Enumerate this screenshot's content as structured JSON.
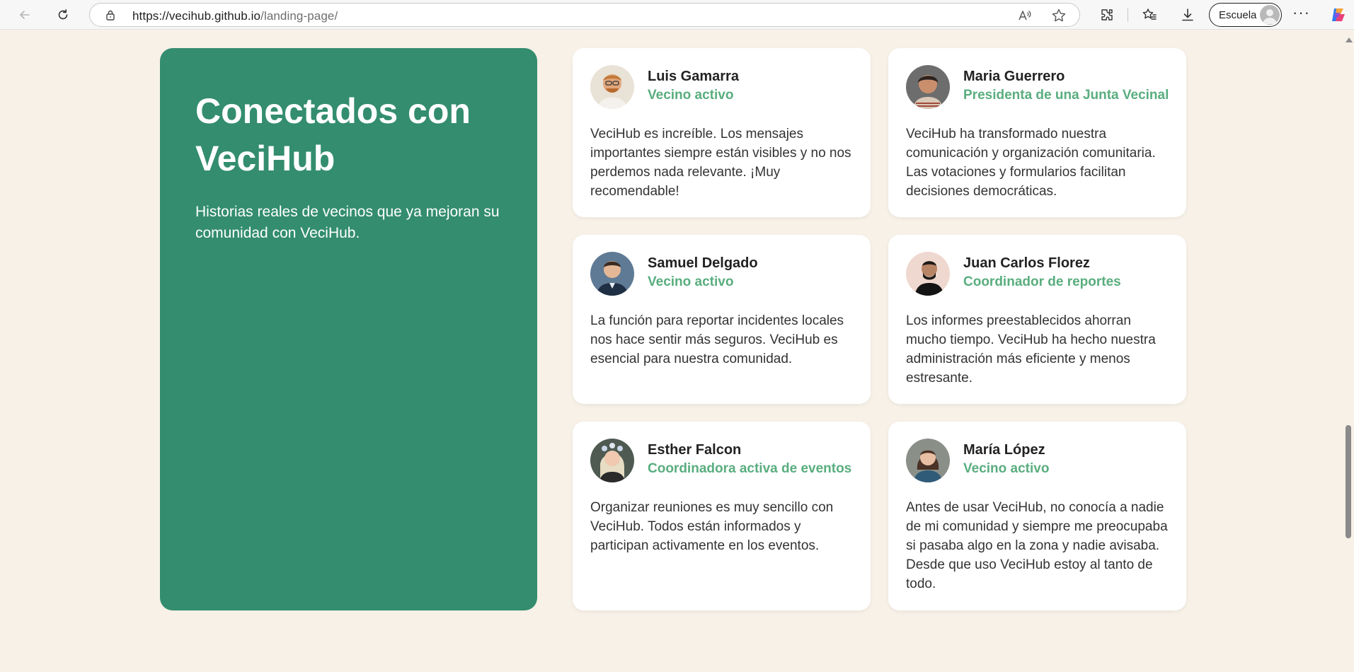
{
  "browser": {
    "url_host": "https://vecihub.github.io",
    "url_path": "/landing-page/",
    "profile_label": "Escuela",
    "more_label": "···"
  },
  "hero": {
    "title": "Conectados con VeciHub",
    "subtitle": "Historias reales de vecinos que ya mejoran su comunidad con VeciHub."
  },
  "testimonials": [
    {
      "name": "Luis Gamarra",
      "role": "Vecino activo",
      "quote": "VeciHub es increíble. Los mensajes importantes siempre están visibles y no nos perdemos nada relevante. ¡Muy recomendable!"
    },
    {
      "name": "Maria Guerrero",
      "role": "Presidenta de una Junta Vecinal",
      "quote": "VeciHub ha transformado nuestra comunicación y organización comunitaria. Las votaciones y formularios facilitan decisiones democráticas."
    },
    {
      "name": "Samuel Delgado",
      "role": "Vecino activo",
      "quote": "La función para reportar incidentes locales nos hace sentir más seguros. VeciHub es esencial para nuestra comunidad."
    },
    {
      "name": "Juan Carlos Florez",
      "role": "Coordinador de reportes",
      "quote": "Los informes preestablecidos ahorran mucho tiempo. VeciHub ha hecho nuestra administración más eficiente y menos estresante."
    },
    {
      "name": "Esther Falcon",
      "role": "Coordinadora activa de eventos",
      "quote": "Organizar reuniones es muy sencillo con VeciHub. Todos están informados y participan activamente en los eventos."
    },
    {
      "name": "María López",
      "role": "Vecino activo",
      "quote": "Antes de usar VeciHub, no conocía a nadie de mi comunidad y siempre me preocupaba si pasaba algo en la zona y nadie avisaba. Desde que uso VeciHub estoy al tanto de todo."
    }
  ],
  "colors": {
    "page_bg": "#f7f1e8",
    "hero_bg": "#338d6e",
    "role_green": "#59ad7e"
  },
  "icons": [
    "back-arrow-icon",
    "refresh-icon",
    "lock-icon",
    "read-aloud-icon",
    "favorite-star-icon",
    "extensions-icon",
    "favorites-icon",
    "downloads-icon",
    "copilot-icon"
  ]
}
